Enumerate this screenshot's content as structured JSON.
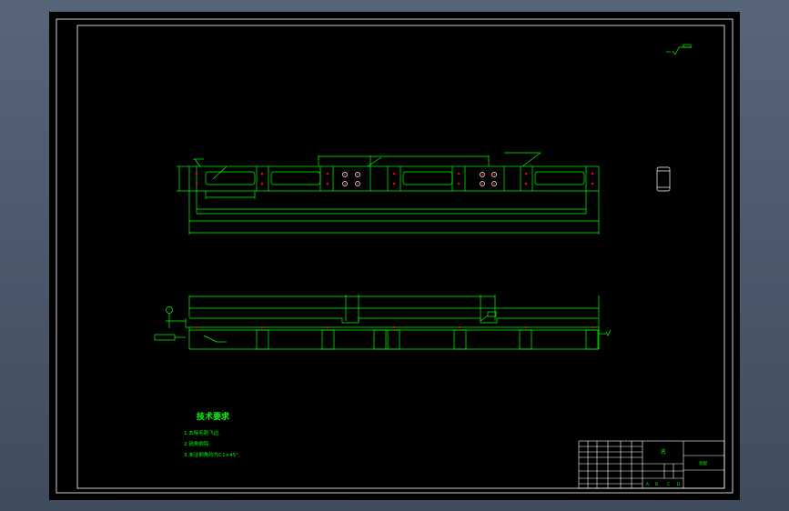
{
  "technical_requirements": {
    "title": "技术要求",
    "items": [
      "1.去除毛刺飞边.",
      "2.锐角倒钝.",
      "3.未注倒角均为C1×45°."
    ]
  },
  "title_block": {
    "label_1": "名",
    "label_2": "装配",
    "scale_marks": [
      "A",
      "B",
      "C",
      "D"
    ]
  },
  "colors": {
    "background": "#000000",
    "frame": "#ffffff",
    "geometry": "#00ff00",
    "hole_marker": "#ff0000",
    "workspace": "#4a5869"
  }
}
